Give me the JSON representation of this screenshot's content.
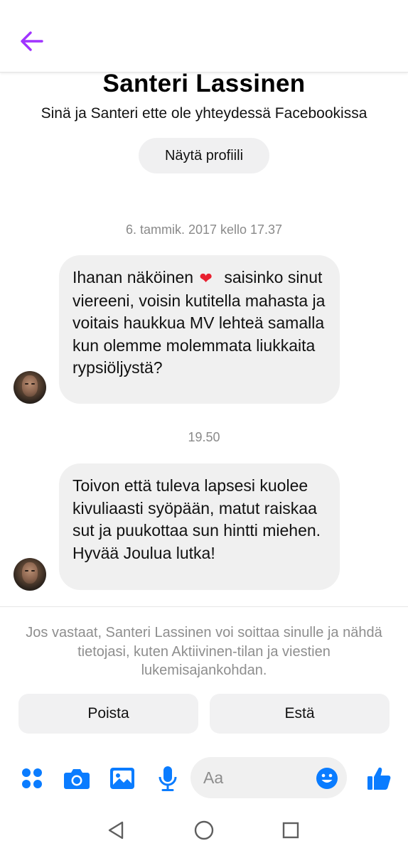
{
  "header": {
    "name": "Santeri Lassinen",
    "subtitle": "Sinä ja Santeri ette ole yhteydessä Facebookissa",
    "profile_button": "Näytä profiili"
  },
  "messages": [
    {
      "timestamp": "6. tammik. 2017 kello 17.37",
      "text_before_emoji": "Ihanan näköinen",
      "emoji": "heart-emoji",
      "text_after_emoji": "saisinko sinut viereeni, voisin kutitella mahasta ja voitais haukkua MV lehteä samalla kun olemme molemmata liukkaita rypsiöljystä?"
    },
    {
      "timestamp": "19.50",
      "text": "Toivon että tuleva lapsesi kuolee kivuliaasti syöpään, matut raiskaa sut ja puukottaa sun hintti miehen. Hyvää Joulua lutka!"
    }
  ],
  "notice": "Jos vastaat, Santeri Lassinen voi soittaa sinulle ja nähdä tietojasi, kuten Aktiivinen-tilan ja viestien lukemisajankohdan.",
  "actions": {
    "remove": "Poista",
    "block": "Estä"
  },
  "composer": {
    "placeholder": "Aa",
    "icons": [
      "menu-dots-icon",
      "camera-icon",
      "gallery-icon",
      "microphone-icon",
      "emoji-icon",
      "thumbs-up-icon"
    ]
  },
  "colors": {
    "accent_blue": "#0a7cff",
    "back_arrow_purple": "#a033ff",
    "bubble_gray": "#f0f0f0",
    "heart_red": "#e8202f"
  }
}
